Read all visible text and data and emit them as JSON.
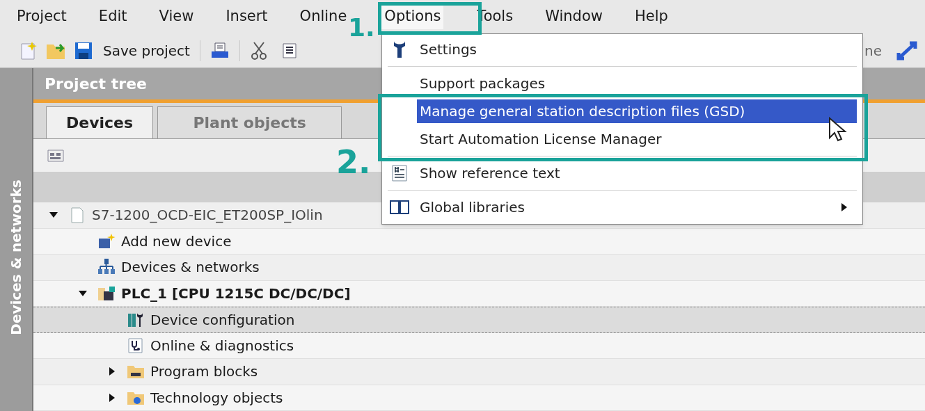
{
  "menubar": [
    {
      "label": "Project",
      "selected": false
    },
    {
      "label": "Edit",
      "selected": false
    },
    {
      "label": "View",
      "selected": false
    },
    {
      "label": "Insert",
      "selected": false
    },
    {
      "label": "Online",
      "selected": false
    },
    {
      "label": "Options",
      "selected": true
    },
    {
      "label": "Tools",
      "selected": false
    },
    {
      "label": "Window",
      "selected": false
    },
    {
      "label": "Help",
      "selected": false
    }
  ],
  "toolbar": {
    "save_label": "Save project",
    "cut_text": "ne"
  },
  "side_strip": {
    "label": "Devices & networks"
  },
  "project_tree": {
    "title": "Project tree",
    "tabs": [
      {
        "label": "Devices",
        "selected": true
      },
      {
        "label": "Plant objects",
        "selected": false
      }
    ],
    "items": [
      {
        "label": "S7-1200_OCD-EIC_ET200SP_IOlin",
        "kind": "project",
        "expanded": true,
        "selected": false,
        "children": [
          {
            "label": "Add new device",
            "kind": "add-device",
            "selected": false
          },
          {
            "label": "Devices & networks",
            "kind": "network",
            "selected": false
          },
          {
            "label": "PLC_1 [CPU 1215C DC/DC/DC]",
            "kind": "plc",
            "expanded": true,
            "selected": false,
            "children": [
              {
                "label": "Device configuration",
                "kind": "config",
                "selected": true
              },
              {
                "label": "Online & diagnostics",
                "kind": "diagnostics",
                "selected": false
              },
              {
                "label": "Program blocks",
                "kind": "blocks",
                "expanded": false,
                "selected": false
              },
              {
                "label": "Technology objects",
                "kind": "tech",
                "expanded": false,
                "selected": false
              }
            ]
          }
        ]
      }
    ]
  },
  "options_menu": {
    "items": [
      {
        "label": "Settings",
        "kind": "settings",
        "selected": false,
        "separator_after": true
      },
      {
        "label": "Support packages",
        "kind": "plain",
        "selected": false,
        "separator_after": false
      },
      {
        "label": "Manage general station description files (GSD)",
        "kind": "plain",
        "selected": true,
        "separator_after": false
      },
      {
        "label": "Start Automation License Manager",
        "kind": "plain",
        "selected": false,
        "separator_after": true
      },
      {
        "label": "Show reference text",
        "kind": "reference",
        "selected": false,
        "separator_after": true
      },
      {
        "label": "Global libraries",
        "kind": "libraries",
        "selected": false,
        "separator_after": false,
        "submenu": true
      }
    ]
  },
  "annotations": [
    {
      "label": "1."
    },
    {
      "label": "2."
    }
  ]
}
